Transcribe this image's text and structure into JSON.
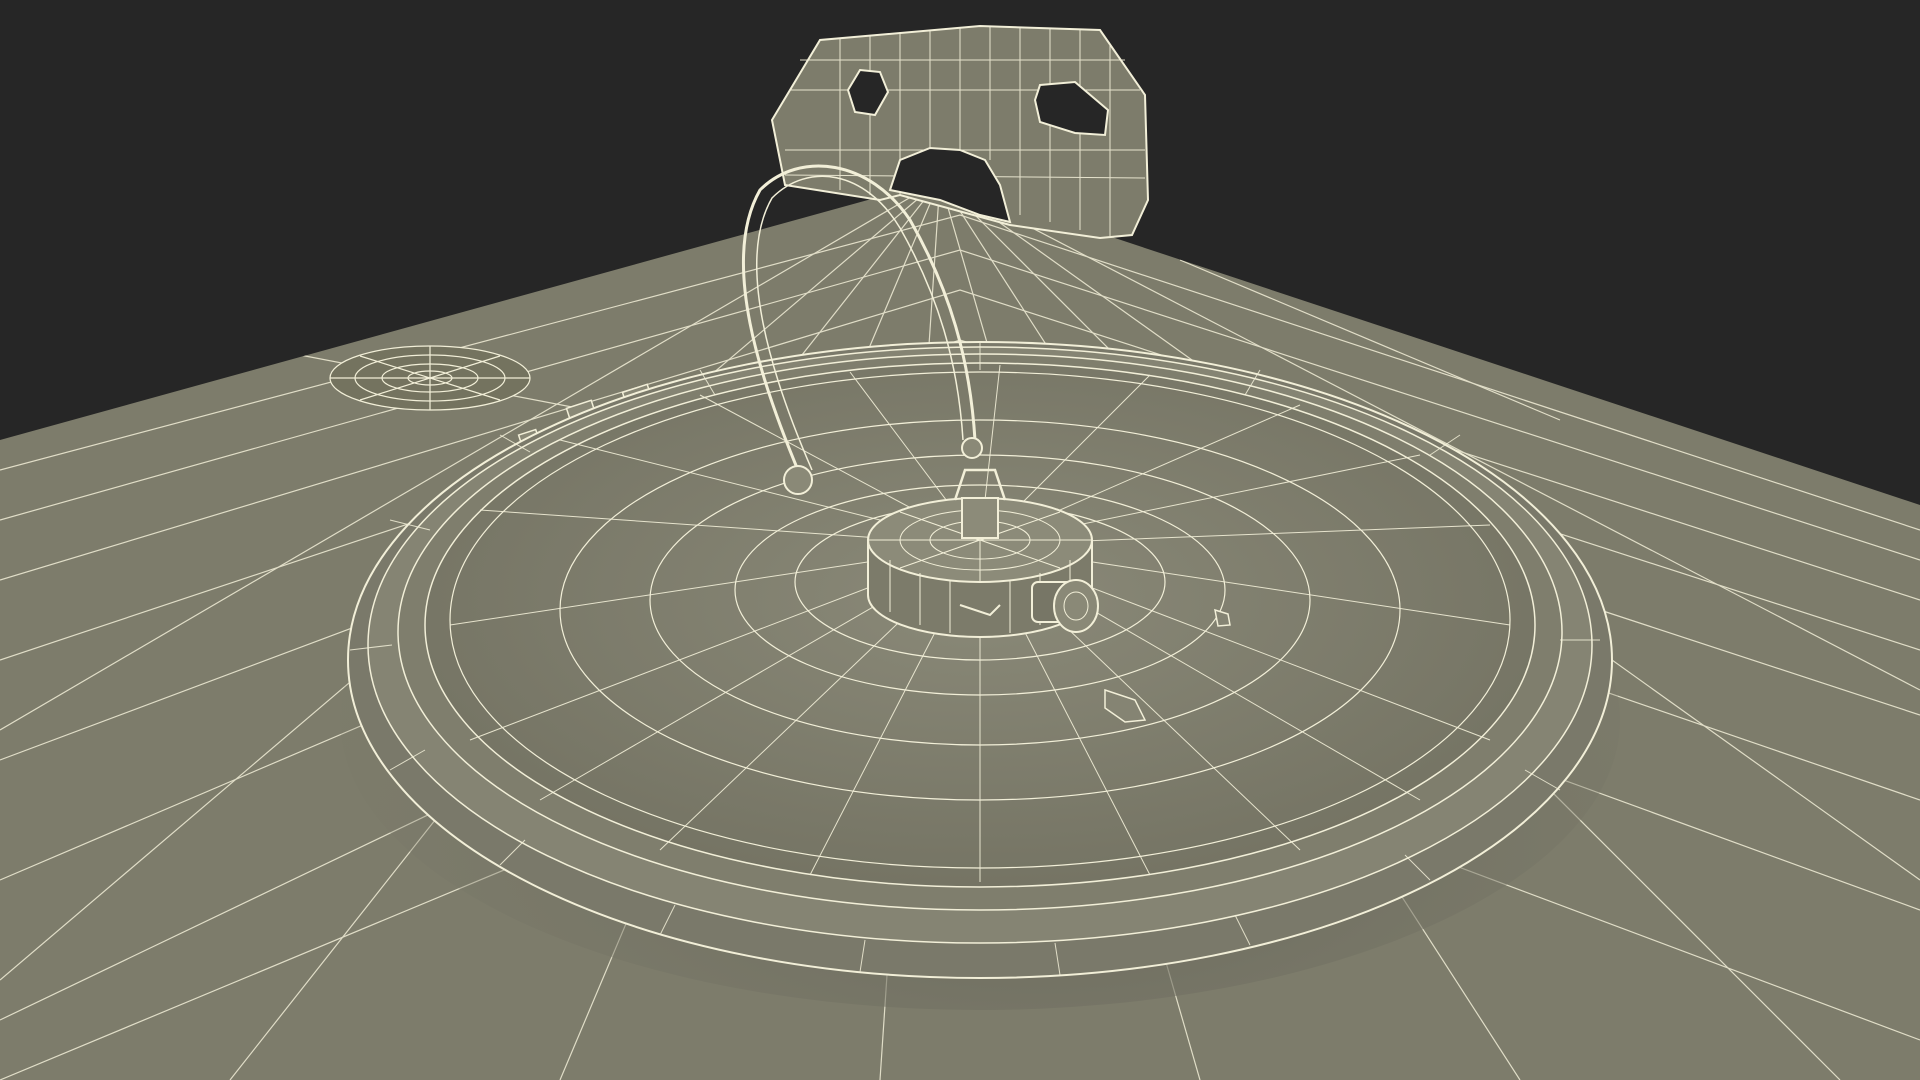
{
  "scene": {
    "subject": "wireframe-render",
    "background_color": "#262626",
    "surface_color": "#7d7c6b",
    "surface_shadow_color": "#5f5e51",
    "wire_color": "#f2efd8",
    "icons": [
      "mounting-bracket",
      "cable-loop",
      "round-lid",
      "center-hub",
      "side-knob",
      "drain-grate",
      "hinge-clips"
    ]
  }
}
